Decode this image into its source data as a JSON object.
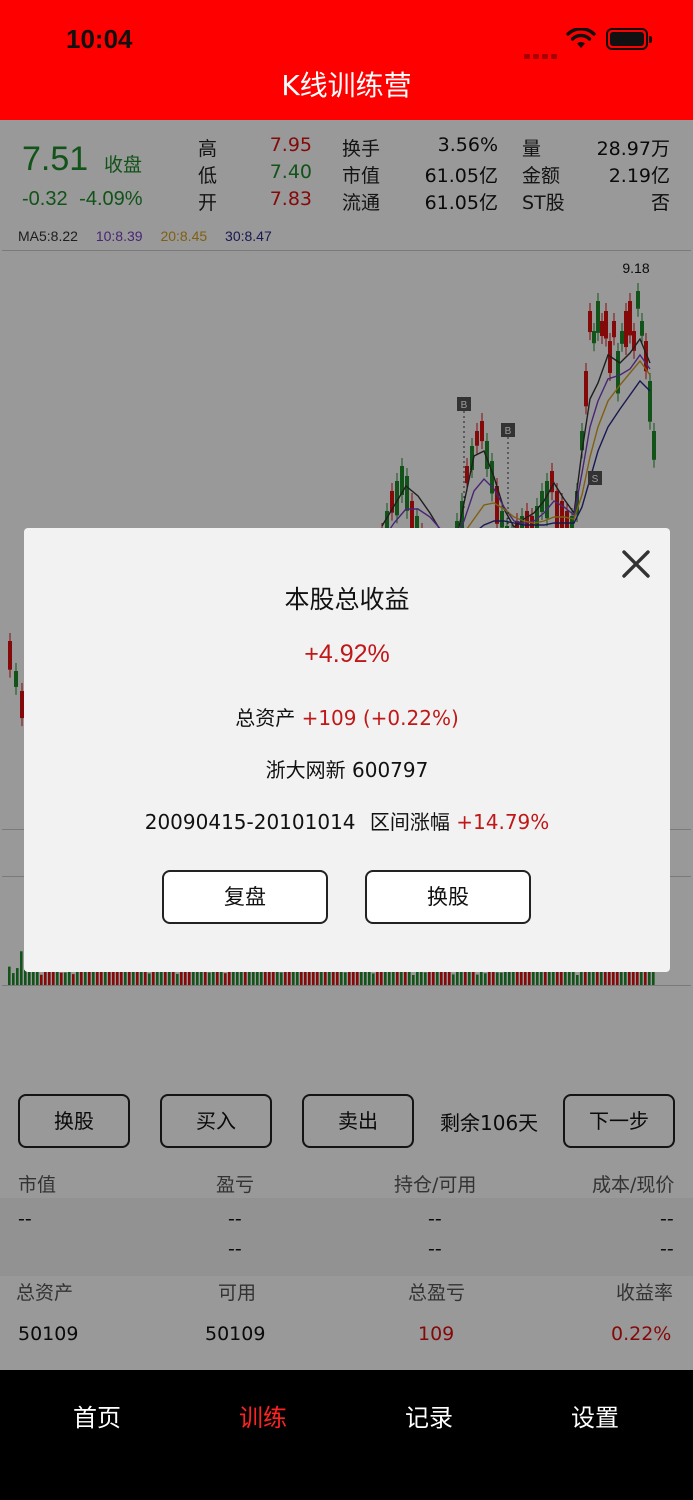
{
  "status": {
    "time": "10:04"
  },
  "app": {
    "title": "K线训练营"
  },
  "quote": {
    "price": "7.51",
    "close_label": "收盘",
    "change": "-0.32",
    "change_pct": "-4.09%",
    "stats": [
      {
        "label": "高",
        "value": "7.95",
        "color": "#d11"
      },
      {
        "label": "低",
        "value": "7.40",
        "color": "#1e8a2a"
      },
      {
        "label": "开",
        "value": "7.83",
        "color": "#d11"
      },
      {
        "label": "换手",
        "value": "3.56%"
      },
      {
        "label": "市值",
        "value": "61.05亿"
      },
      {
        "label": "流通",
        "value": "61.05亿"
      },
      {
        "label": "量",
        "value": "28.97万"
      },
      {
        "label": "金额",
        "value": "2.19亿"
      },
      {
        "label": "ST股",
        "value": "否"
      }
    ]
  },
  "ma": {
    "ma5": "MA5:8.22",
    "ma10": "10:8.39",
    "ma20": "20:8.45",
    "ma30": "30:8.47",
    "colors": {
      "ma5": "#333333",
      "ma10": "#7b3fc4",
      "ma20": "#d4a020",
      "ma30": "#2a2a8a"
    }
  },
  "kline": {
    "high_label": "9.18",
    "markers": [
      "B",
      "B",
      "S"
    ]
  },
  "controls": {
    "change_stock": "换股",
    "buy": "买入",
    "sell": "卖出",
    "remaining": "剩余106天",
    "next": "下一步"
  },
  "position_table": {
    "headers": [
      "市值",
      "盈亏",
      "持仓/可用",
      "成本/现价"
    ],
    "row1": [
      "--",
      "--",
      "--",
      "--"
    ],
    "row2": [
      "--",
      "--",
      "--"
    ]
  },
  "asset_table": {
    "headers": [
      "总资产",
      "可用",
      "总盈亏",
      "收益率"
    ],
    "values": [
      "50109",
      "50109",
      "109",
      "0.22%"
    ]
  },
  "tabs": [
    "首页",
    "训练",
    "记录",
    "设置"
  ],
  "modal": {
    "title": "本股总收益",
    "return_pct": "+4.92%",
    "assets_label": "总资产",
    "assets_value": "+109 (+0.22%)",
    "stock": "浙大网新 600797",
    "period": "20090415-20101014",
    "range_label": "区间涨幅",
    "range_value": "+14.79%",
    "replay_button": "复盘",
    "change_button": "换股"
  }
}
